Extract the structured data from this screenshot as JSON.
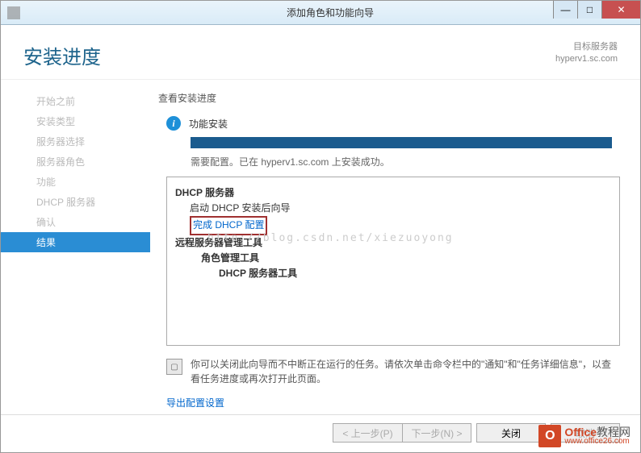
{
  "titlebar": {
    "title": "添加角色和功能向导"
  },
  "header": {
    "page_title": "安装进度",
    "target_label": "目标服务器",
    "target_value": "hyperv1.sc.com"
  },
  "sidebar": {
    "items": [
      {
        "label": "开始之前"
      },
      {
        "label": "安装类型"
      },
      {
        "label": "服务器选择"
      },
      {
        "label": "服务器角色"
      },
      {
        "label": "功能"
      },
      {
        "label": "DHCP 服务器"
      },
      {
        "label": "确认"
      },
      {
        "label": "结果"
      }
    ]
  },
  "main": {
    "subtitle": "查看安装进度",
    "status": "功能安装",
    "progress_msg": "需要配置。已在 hyperv1.sc.com 上安装成功。",
    "detail": {
      "l1": "DHCP 服务器",
      "l2": "启动 DHCP 安装后向导",
      "l3": "完成 DHCP 配置",
      "l4": "远程服务器管理工具",
      "l5": "角色管理工具",
      "l6": "DHCP 服务器工具"
    },
    "watermark": "http://blog.csdn.net/xiezuoyong",
    "notice": "你可以关闭此向导而不中断正在运行的任务。请依次单击命令栏中的\"通知\"和\"任务详细信息\"，以查看任务进度或再次打开此页面。",
    "export_link": "导出配置设置"
  },
  "footer": {
    "prev": "< 上一步(P)",
    "next": "下一步(N) >",
    "close": "关闭",
    "cancel": "取消"
  },
  "branding": {
    "text_main": "Office",
    "text_suffix": "教程网",
    "url": "www.office26.com"
  }
}
